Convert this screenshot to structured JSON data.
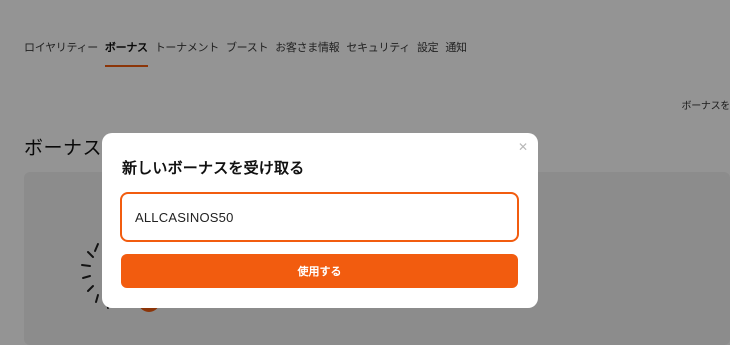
{
  "nav": {
    "tabs": [
      {
        "label": "ロイヤリティー",
        "active": false
      },
      {
        "label": "ボーナス",
        "active": true
      },
      {
        "label": "トーナメント",
        "active": false
      },
      {
        "label": "ブースト",
        "active": false
      },
      {
        "label": "お客さま情報",
        "active": false
      },
      {
        "label": "セキュリティ",
        "active": false
      },
      {
        "label": "設定",
        "active": false
      },
      {
        "label": "通知",
        "active": false
      }
    ]
  },
  "history_link": "ボーナスを",
  "page_title": "ボーナス",
  "modal": {
    "title": "新しいボーナスを受け取る",
    "close_icon": "close-icon",
    "code_value": "ALLCASINOS50",
    "button_label": "使用する"
  },
  "colors": {
    "accent": "#f25c0f",
    "overlay": "rgba(0,0,0,0.42)"
  }
}
